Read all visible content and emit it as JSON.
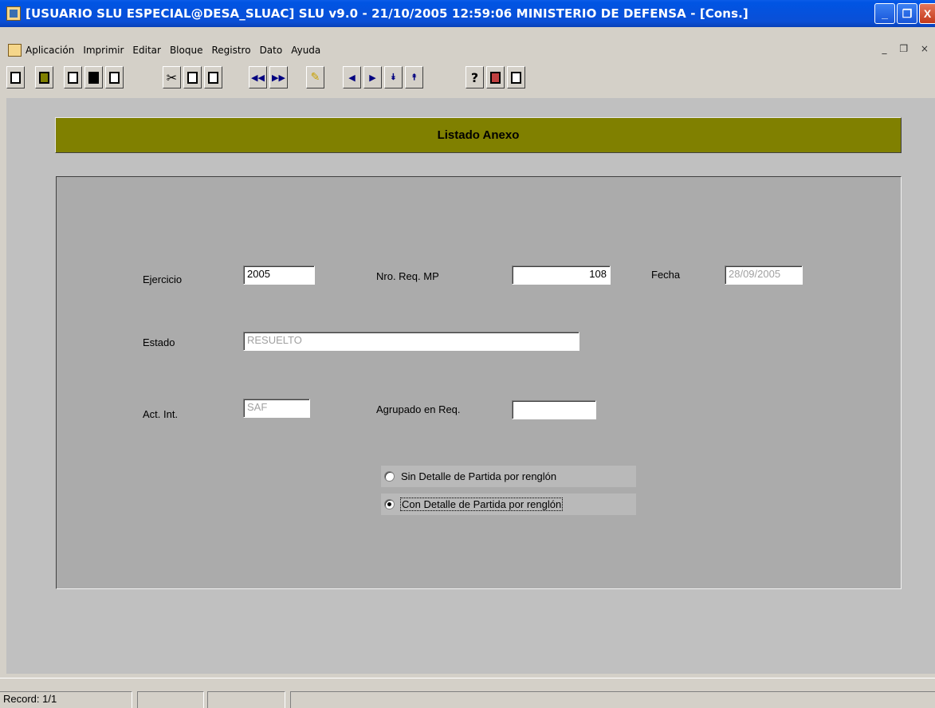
{
  "window": {
    "title": "[USUARIO SLU ESPECIAL@DESA_SLUAC]  SLU v9.0 - 21/10/2005 12:59:06 MINISTERIO DE DEFENSA - [Cons.]",
    "buttons": {
      "minimize": "_",
      "restore": "❐",
      "close": "X"
    }
  },
  "menu": {
    "items": [
      "Aplicación",
      "Imprimir",
      "Editar",
      "Bloque",
      "Registro",
      "Dato",
      "Ayuda"
    ],
    "mdi_controls": "_ ❐ ×"
  },
  "toolbar": {
    "icons": [
      "print-icon",
      "exit-icon",
      "window-icon",
      "save-icon",
      "print-preview-icon",
      "cut-icon",
      "copy-icon",
      "paste-icon",
      "prev-block-icon",
      "next-block-icon",
      "clear-icon",
      "prev-record-icon",
      "next-record-icon",
      "last-record-icon",
      "first-record-icon",
      "help-icon",
      "list-icon",
      "document-icon"
    ],
    "labels": {
      "help": "?"
    }
  },
  "form": {
    "header": "Listado Anexo",
    "ejercicio": {
      "label": "Ejercicio",
      "value": "2005"
    },
    "nro_req": {
      "label": "Nro. Req. MP",
      "value": "108"
    },
    "fecha": {
      "label": "Fecha",
      "value": "28/09/2005"
    },
    "estado": {
      "label": "Estado",
      "value": "RESUELTO"
    },
    "act_int": {
      "label": "Act. Int.",
      "value": "SAF"
    },
    "agrupado": {
      "label": "Agrupado en Req.",
      "value": ""
    },
    "options": [
      {
        "label": "Sin Detalle de Partida por renglón",
        "selected": false
      },
      {
        "label": "Con Detalle de Partida por renglón",
        "selected": true
      }
    ]
  },
  "status": {
    "record": "Record: 1/1"
  }
}
